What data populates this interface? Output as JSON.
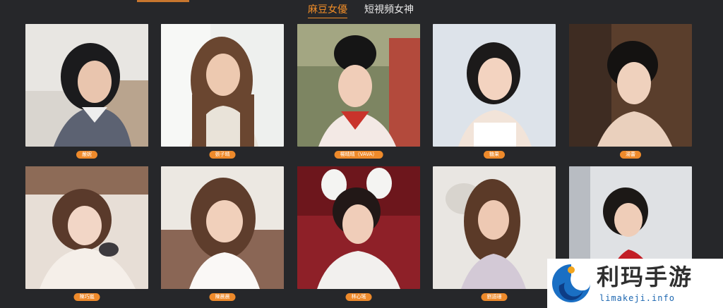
{
  "tabs": [
    {
      "label": "麻豆女優",
      "active": true
    },
    {
      "label": "短視頻女神",
      "active": false
    }
  ],
  "actresses": [
    {
      "name": "嚴妮",
      "scheme": "a"
    },
    {
      "name": "張子晴",
      "scheme": "b"
    },
    {
      "name": "楊晴晴（VAVA）",
      "scheme": "c"
    },
    {
      "name": "糖果",
      "scheme": "d"
    },
    {
      "name": "湯蕾",
      "scheme": "e"
    },
    {
      "name": "陳巧嵐",
      "scheme": "f"
    },
    {
      "name": "陳晨晨",
      "scheme": "g"
    },
    {
      "name": "林心瑤",
      "scheme": "h"
    },
    {
      "name": "劉語珊",
      "scheme": "i"
    },
    {
      "name": "",
      "scheme": "j"
    }
  ],
  "colors": {
    "background": "#26272a",
    "accent": "#ee8a2b",
    "active_tab": "#f08d28"
  },
  "watermark": {
    "title": "利玛手游",
    "url": "limakeji.info",
    "icon": "swirl-logo-icon"
  }
}
